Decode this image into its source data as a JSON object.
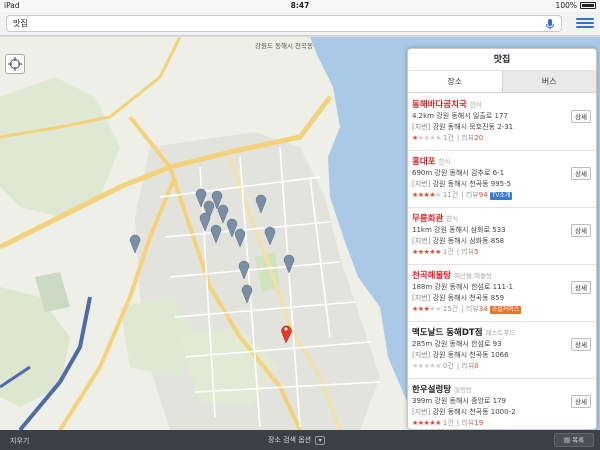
{
  "status": {
    "device": "iPad",
    "time": "8:47",
    "battery": "100%"
  },
  "search": {
    "query": "맛집"
  },
  "map": {
    "region_label": "강원도 동해시 천곡동"
  },
  "panel": {
    "title": "맛집",
    "tabs": [
      "장소",
      "버스"
    ],
    "detail_label": "상세",
    "address_tag": "[지번]",
    "results": [
      {
        "name": "동해바다곰치국",
        "category": "한식",
        "distance": "4.2km",
        "road": "강원 동해시 일출로 177",
        "jibun": "강원 동해시 묵호진동 2-31",
        "stars": 1,
        "count": "1건",
        "review_label": "리뷰",
        "reviews": "20",
        "badge": ""
      },
      {
        "name": "홍대포",
        "category": "한식",
        "distance": "690m",
        "road": "강원 동해시 감추로 6-1",
        "jibun": "강원 동해시 천곡동 995-5",
        "stars": 4,
        "count": "11건",
        "review_label": "리뷰",
        "reviews": "94",
        "badge": "TV소개"
      },
      {
        "name": "무릉회관",
        "category": "한식",
        "distance": "11km",
        "road": "강원 동해시 삼화로 533",
        "jibun": "강원 동해시 삼화동 858",
        "stars": 5,
        "count": "1건",
        "review_label": "리뷰",
        "reviews": "5",
        "badge": ""
      },
      {
        "name": "천곡해물탕",
        "category": "해산물,해물탕",
        "distance": "188m",
        "road": "강원 동해시 한섬로 111-1",
        "jibun": "강원 동해시 천곡동 859",
        "stars": 3,
        "count": "15건",
        "review_label": "리뷰",
        "reviews": "34",
        "badge": "소셜커머스"
      },
      {
        "name": "맥도날드 동해DT점",
        "category": "패스트푸드",
        "distance": "285m",
        "road": "강원 동해시 한섬로 93",
        "jibun": "강원 동해시 천곡동 1066",
        "stars": 0,
        "count": "0건",
        "review_label": "리뷰",
        "reviews": "0",
        "badge": ""
      },
      {
        "name": "한우설렁탕",
        "category": "설렁탕",
        "distance": "399m",
        "road": "강원 동해시 중앙로 179",
        "jibun": "강원 동해시 천곡동 1000-2",
        "stars": 5,
        "count": "1건",
        "review_label": "리뷰",
        "reviews": "19",
        "badge": ""
      }
    ]
  },
  "bottom": {
    "clear": "지우기",
    "options": "장소 검색 옵션",
    "list": "목록"
  },
  "colors": {
    "accent": "#2f6fd6",
    "name_red": "#d22222",
    "star": "#e34b26",
    "sea": "#a9c9e6",
    "land": "#eef0e8",
    "pin": "#7a8ea6",
    "selected_pin": "#e83a2a"
  }
}
